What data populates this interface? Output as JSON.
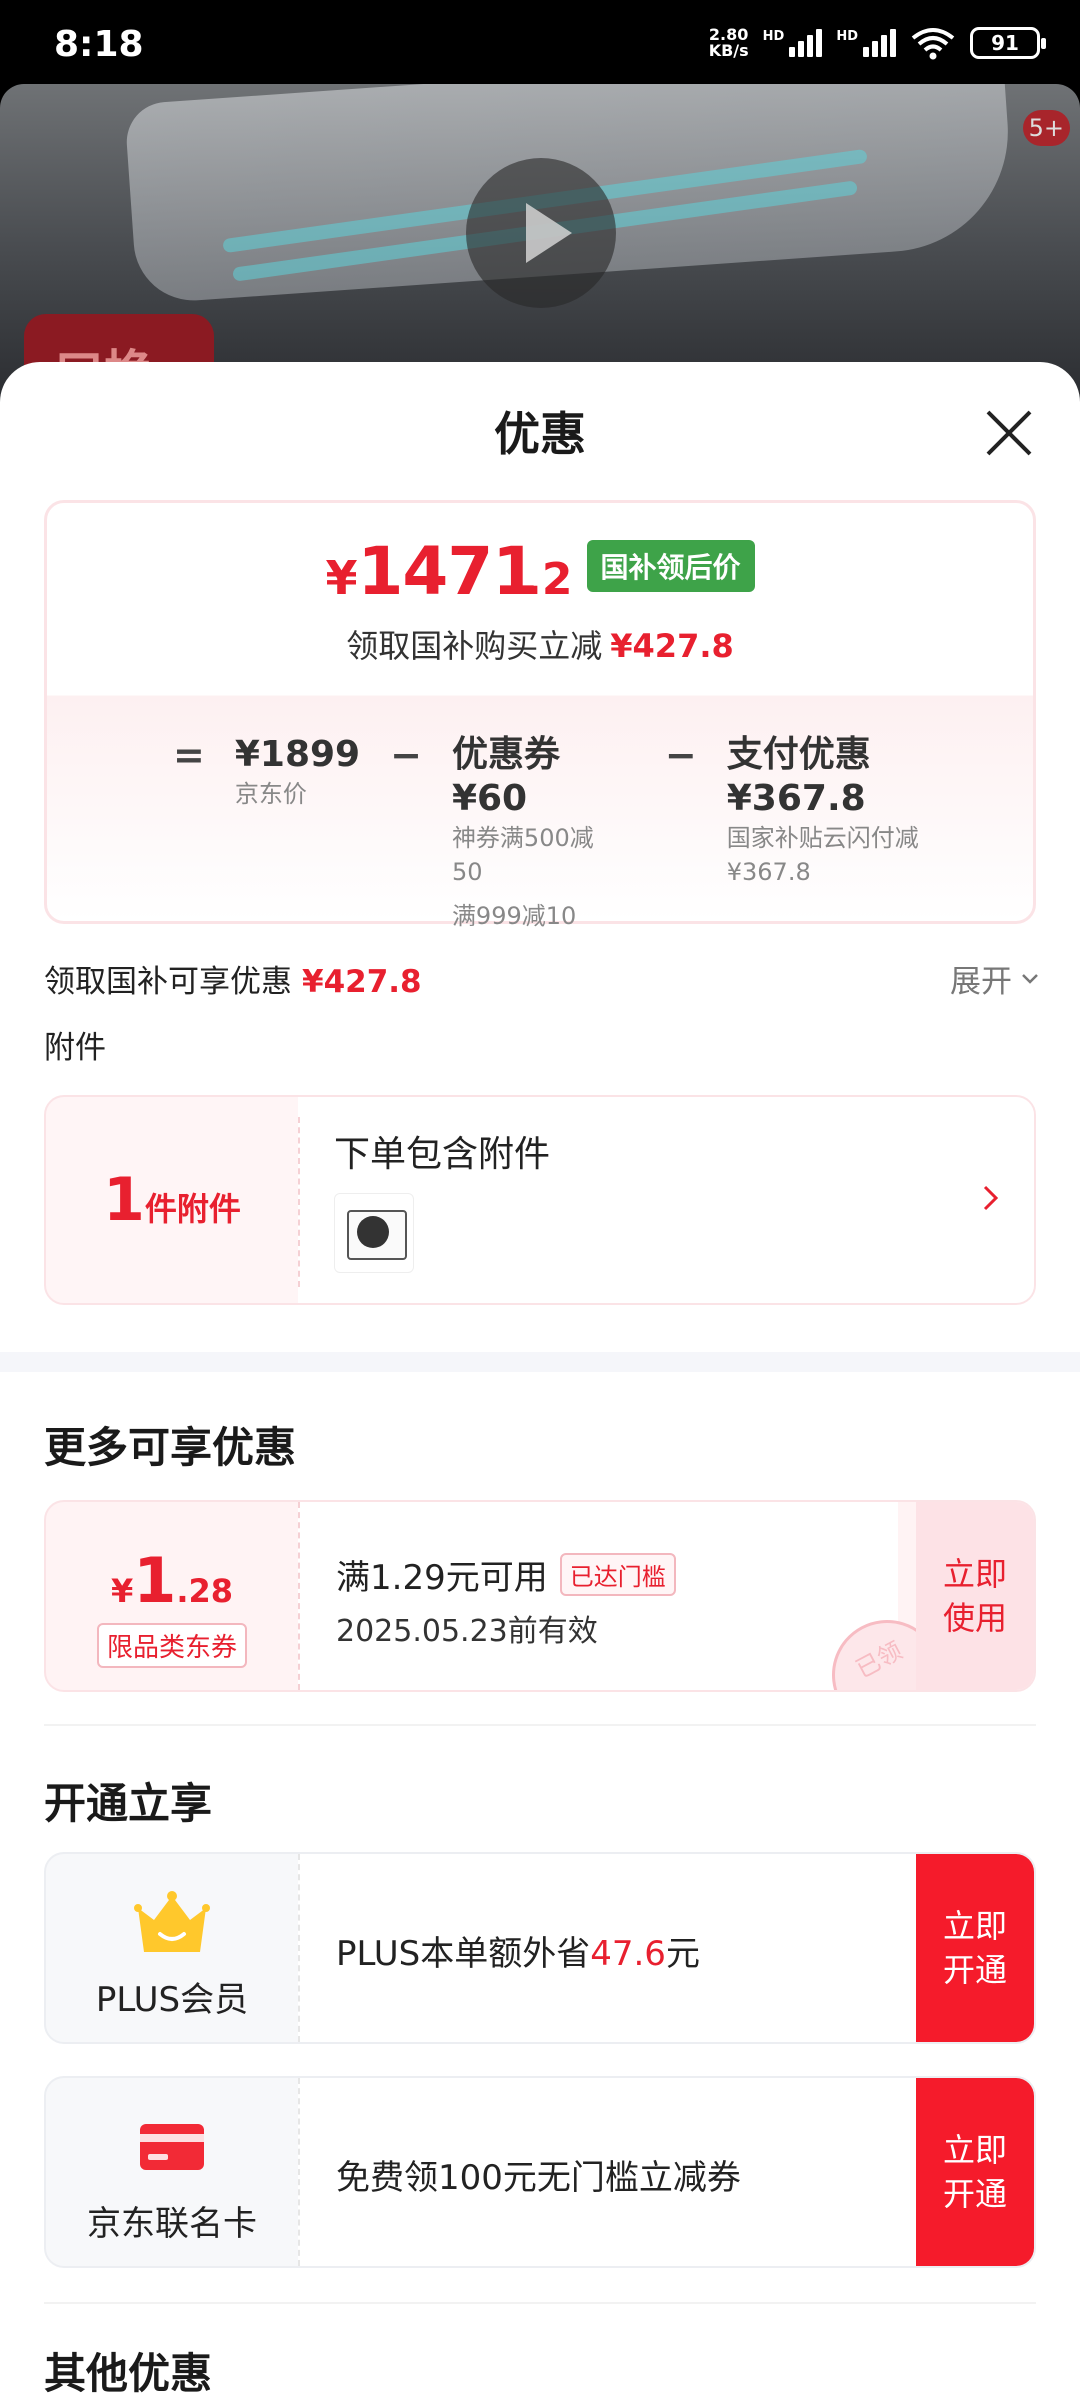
{
  "status": {
    "time": "8:18",
    "net_speed_top": "2.80",
    "net_speed_bottom": "KB/s",
    "hd1": "HD",
    "hd2": "HD",
    "battery": "91"
  },
  "product": {
    "badge": "5+",
    "tag": "口换"
  },
  "sheet": {
    "title": "优惠"
  },
  "summary": {
    "currency": "¥",
    "price_int": "1471",
    "price_dec": ".2",
    "tag": "国补领后价",
    "reduce_text": "领取国补购买立减",
    "reduce_amount": "¥427.8",
    "eq": "=",
    "minus": "−",
    "items": [
      {
        "main": "¥1899",
        "sub1": "京东价"
      },
      {
        "main": "优惠券 ¥60",
        "sub1": "神券满500减",
        "sub2": "50",
        "sub3": "满999减10"
      },
      {
        "main": "支付优惠 ¥367.8",
        "sub1": "国家补贴云闪付减",
        "sub2": "¥367.8"
      }
    ]
  },
  "enjoy": {
    "text": "领取国补可享优惠",
    "amount": "¥427.8",
    "expand": "展开"
  },
  "accessory": {
    "section": "附件",
    "count": "1",
    "unit": "件附件",
    "title": "下单包含附件"
  },
  "more": {
    "title": "更多可享优惠",
    "coupon": {
      "currency": "¥",
      "int": "1",
      "dec": ".28",
      "type": "限品类东券",
      "condition": "满1.29元可用",
      "reached": "已达门槛",
      "date": "2025.05.23前有效",
      "stamp": "已领",
      "action": "立即使用"
    }
  },
  "open": {
    "title": "开通立享",
    "plus": {
      "label": "PLUS会员",
      "text_prefix": "PLUS本单额外省",
      "amount": "47.6",
      "text_suffix": "元",
      "action": "立即开通"
    },
    "card": {
      "label": "京东联名卡",
      "text": "免费领100元无门槛立减券",
      "action": "立即开通"
    }
  },
  "other": {
    "title": "其他优惠"
  },
  "colors": {
    "accent_red": "#e8202f",
    "green_tag": "#3ea349",
    "action_red": "#f51b2b"
  }
}
